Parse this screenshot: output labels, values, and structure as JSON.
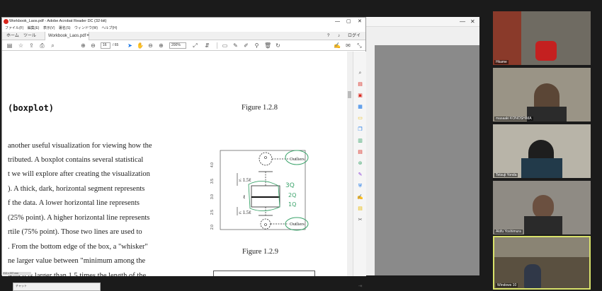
{
  "acrobat": {
    "title": "Workbook_Laos.pdf - Adobe Acrobat Reader DC (32-bit)",
    "menu": [
      "ファイル(F)",
      "編集(E)",
      "表示(V)",
      "署名(S)",
      "ウィンドウ(W)",
      "ヘルプ(H)"
    ],
    "tabs": [
      "ホーム",
      "ツール",
      "Workbook_Laos.pdf"
    ],
    "login": "ログイン",
    "page_current": "16",
    "page_total": "/ 65",
    "zoom": "200%",
    "status": "210 x 297 mm"
  },
  "document": {
    "heading": "(boxplot)",
    "paragraph": [
      "another useful visualization for viewing how the",
      "tributed. A boxplot contains several statistical",
      "t we will explore after creating the visualization",
      ").  A thick, dark, horizontal segment represents",
      "f the data.  A lower horizontal line represents",
      " (25% point). A higher horizontal line represents",
      "rtile (75% point).  Those two lines are used to",
      ".  From the bottom edge of the box, a \"whisker\"",
      "ne larger value between \"minimum among the",
      "which is larger than 1.5 times the length of the"
    ],
    "figure_1": "Figure 1.2.8",
    "figure_2": "Figure 1.2.9",
    "boxplot": {
      "y_ticks": [
        "4.0",
        "3.5",
        "3.0",
        "2.5",
        "2.0"
      ],
      "label_outliers": "Outliers",
      "label_whisker": "≤ 1.5ℓ",
      "label_l": "ℓ",
      "handwritten": [
        "3Q",
        "2Q",
        "1Q"
      ]
    }
  },
  "participants": [
    {
      "name": "Hkame"
    },
    {
      "name": "masaaki KONOSHIMA"
    },
    {
      "name": "Tetsuji Yonda"
    },
    {
      "name": "Akifu Yoshimura"
    },
    {
      "name": "Windows 10"
    }
  ],
  "taskbar_preview": {
    "title": "チャット"
  },
  "colors": {
    "acrobat_red": "#d9261c",
    "accent_blue": "#1473e6",
    "annotation_green": "#3aa36a",
    "active_speaker": "#d9e26a"
  }
}
